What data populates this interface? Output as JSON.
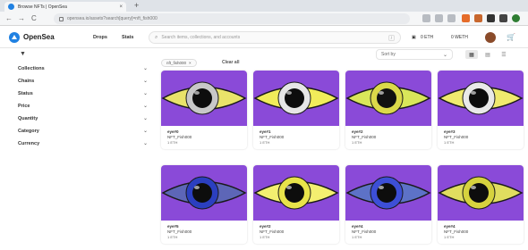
{
  "browser": {
    "tab_title": "Browse NFTs | OpenSea",
    "tab_close": "×",
    "new_tab": "+",
    "nav_back": "←",
    "nav_forward": "→",
    "nav_reload": "C",
    "url": "opensea.io/assets?search[query]=nft_fish000"
  },
  "header": {
    "brand": "OpenSea",
    "nav": [
      "Drops",
      "Stats"
    ],
    "search_placeholder": "Search items, collections, and accounts",
    "search_shortcut": "/",
    "wallet": "0 ETH",
    "balance": "0 WETH",
    "cart": "🛒"
  },
  "filterbar": {
    "toggle_icon": "▼",
    "chip": "nft_fish000",
    "chip_close": "×",
    "clear_all": "Clear all",
    "sort_label": "Sort by"
  },
  "sidebar": {
    "items": [
      "Collections",
      "Chains",
      "Status",
      "Price",
      "Quantity",
      "Category",
      "Currency"
    ]
  },
  "cards": [
    {
      "name": "eye#0",
      "collection": "NFT_Fish000",
      "price": "1 ETH",
      "sclera": "#e9e36a",
      "iris": "#c8c8c8",
      "pupil": "#0d0d0d"
    },
    {
      "name": "eye#1",
      "collection": "NFT_Fish000",
      "price": "1 ETH",
      "sclera": "#f1ec5a",
      "iris": "#e6e6e6",
      "pupil": "#0d0d0d"
    },
    {
      "name": "eye#2",
      "collection": "NFT_Fish000",
      "price": "1 ETH",
      "sclera": "#d9e65a",
      "iris": "#dbd94a",
      "pupil": "#111111"
    },
    {
      "name": "eye#3",
      "collection": "NFT_Fish000",
      "price": "1 ETH",
      "sclera": "#f0ea6e",
      "iris": "#e9e9e9",
      "pupil": "#0d0d0d"
    },
    {
      "name": "eye#5",
      "collection": "NFT_Fish000",
      "price": "1 ETH",
      "sclera": "#5d66b7",
      "iris": "#2b3fc0",
      "pupil": "#0d0d0d"
    },
    {
      "name": "eye#2",
      "collection": "NFT_Fish000",
      "price": "1 ETH",
      "sclera": "#f3ef70",
      "iris": "#e8e34a",
      "pupil": "#0d0d0d"
    },
    {
      "name": "eye#4",
      "collection": "NFT_Fish000",
      "price": "1 ETH",
      "sclera": "#5d72c7",
      "iris": "#3d4fd6",
      "pupil": "#0d0d0d"
    },
    {
      "name": "eye#4",
      "collection": "NFT_Fish000",
      "price": "1 ETH",
      "sclera": "#e0dd5f",
      "iris": "#d6d23e",
      "pupil": "#0d0d0d"
    }
  ],
  "colors": {
    "card_background": "#8a4ad8",
    "accent": "#2081e2"
  }
}
